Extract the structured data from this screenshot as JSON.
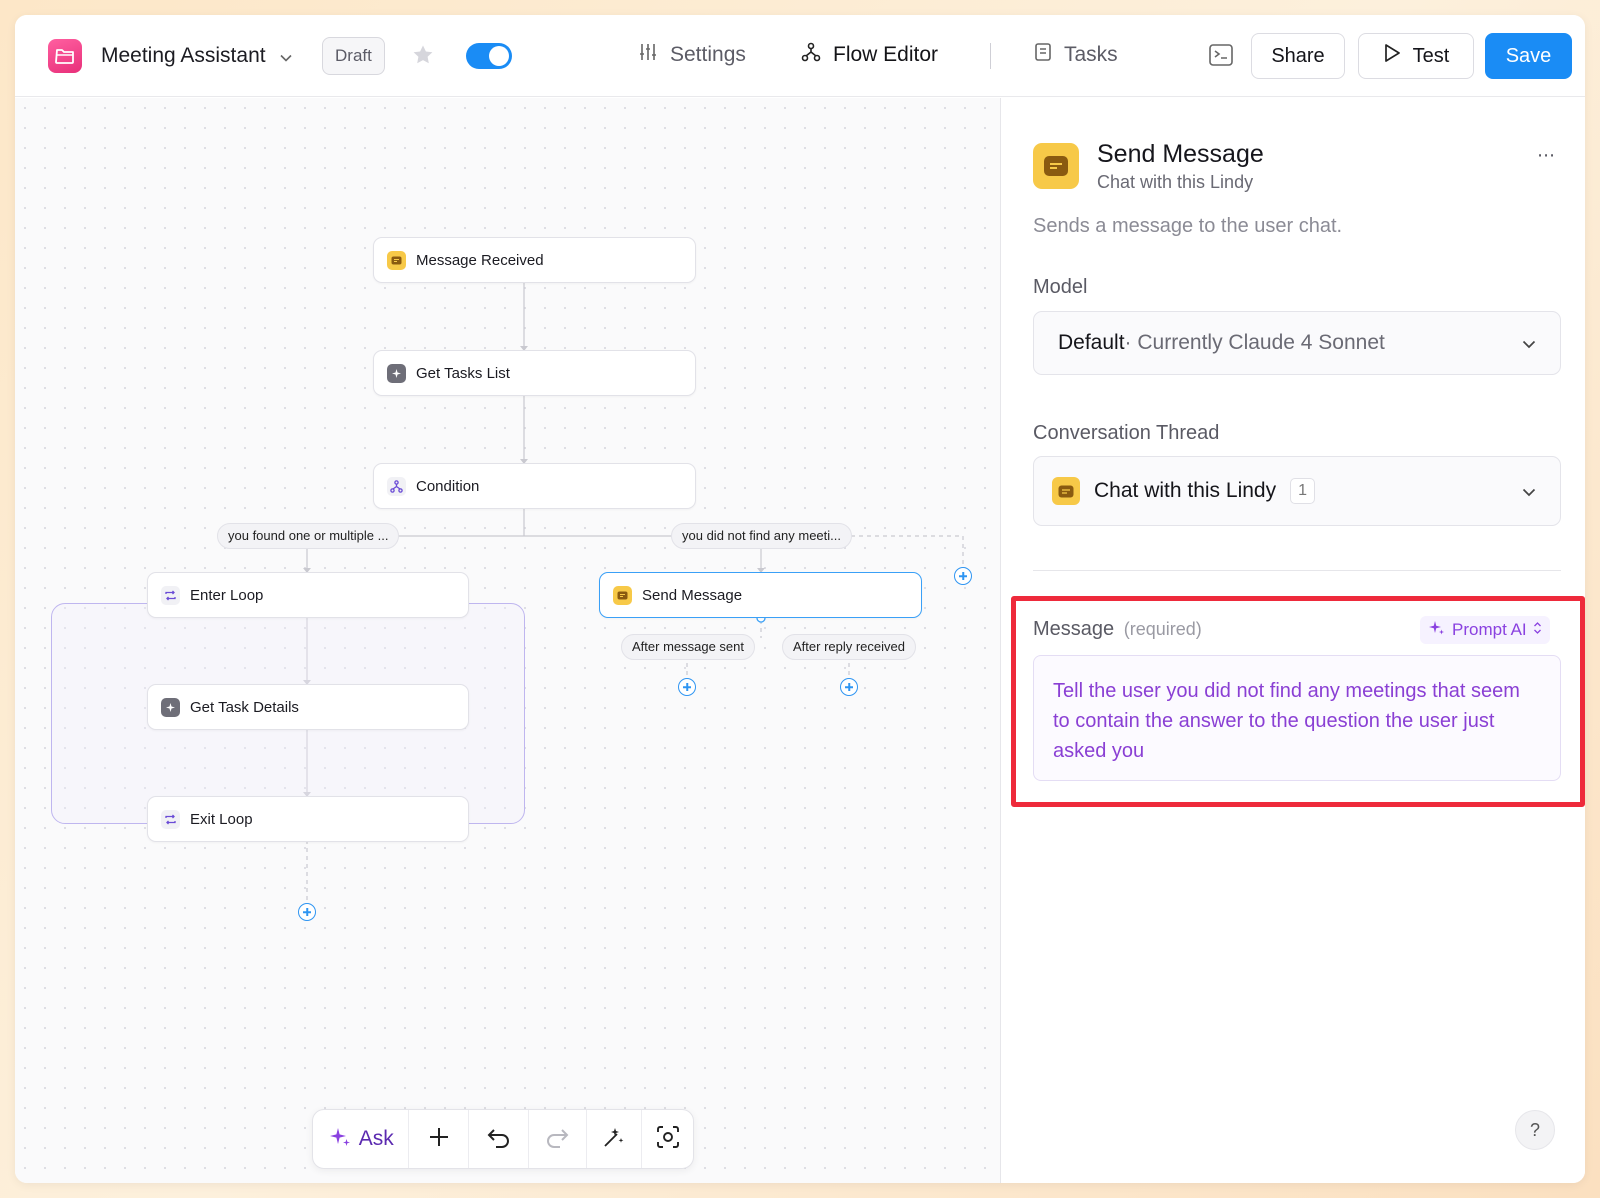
{
  "header": {
    "app_title": "Meeting Assistant",
    "status_badge": "Draft",
    "nav": {
      "settings": "Settings",
      "flow_editor": "Flow Editor",
      "tasks": "Tasks"
    },
    "share_label": "Share",
    "test_label": "Test",
    "save_label": "Save",
    "active_toggle_on": true
  },
  "flow": {
    "nodes": {
      "message_received": "Message Received",
      "get_tasks_list": "Get Tasks List",
      "condition": "Condition",
      "enter_loop": "Enter Loop",
      "get_task_details": "Get Task Details",
      "exit_loop": "Exit Loop",
      "send_message": "Send Message"
    },
    "branches": {
      "found": "you found one or multiple ...",
      "not_found": "you did not find any meeti..."
    },
    "send_message_outputs": {
      "after_sent": "After message sent",
      "after_reply": "After reply received"
    },
    "selected_node": "Send Message"
  },
  "toolbar": {
    "ask_label": "Ask"
  },
  "panel": {
    "title": "Send Message",
    "subtitle": "Chat with this Lindy",
    "description": "Sends a message to the user chat.",
    "model": {
      "label": "Model",
      "value_strong": "Default",
      "value_rest": " · Currently Claude 4 Sonnet"
    },
    "thread": {
      "label": "Conversation Thread",
      "value": "Chat with this Lindy",
      "count": "1"
    },
    "message": {
      "label": "Message",
      "required": "(required)",
      "mode": "Prompt AI",
      "text": "Tell the user you did not find any meetings that seem to contain the answer to the question the user just asked you"
    }
  },
  "help_label": "?",
  "colors": {
    "accent": "#1a8cf5",
    "highlight": "#ee2a3b",
    "prompt_purple": "#8a3fd4",
    "chat_yellow": "#f7c948",
    "app_pink": "#e8307a"
  }
}
